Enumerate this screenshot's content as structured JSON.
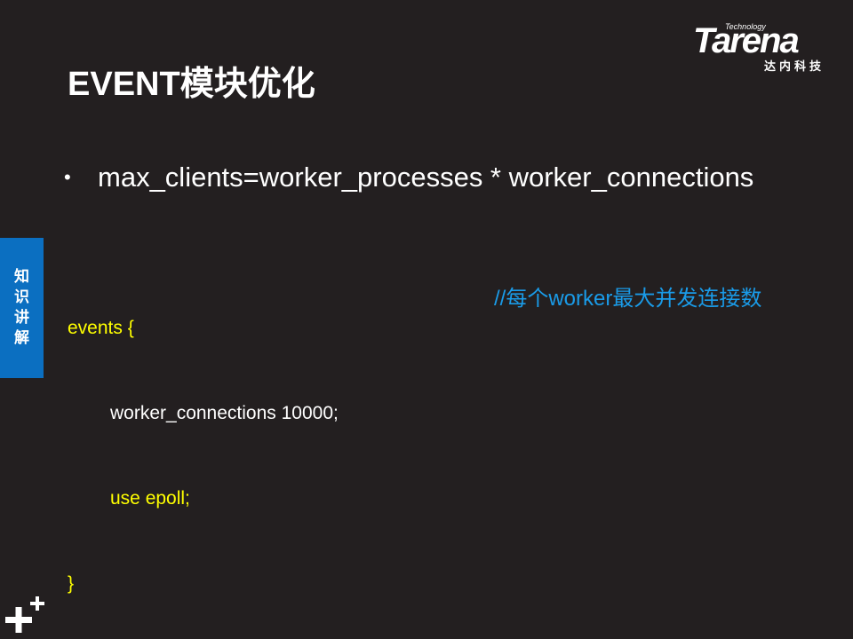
{
  "logo": {
    "sub": "Technology",
    "main": "Tarena",
    "cn": "达内科技"
  },
  "title": "EVENT模块优化",
  "bullet": "max_clients=worker_processes * worker_connections",
  "side_tab": [
    "知",
    "识",
    "讲",
    "解"
  ],
  "code": {
    "line1": "events {",
    "line2": "worker_connections 10000;",
    "line3": "use epoll;",
    "line4": "}"
  },
  "comment": "//每个worker最大并发连接数",
  "colors": {
    "background": "#231f20",
    "code_yellow": "#ffff00",
    "comment_blue": "#1a9be8",
    "tab_blue": "#0b6fc1"
  }
}
